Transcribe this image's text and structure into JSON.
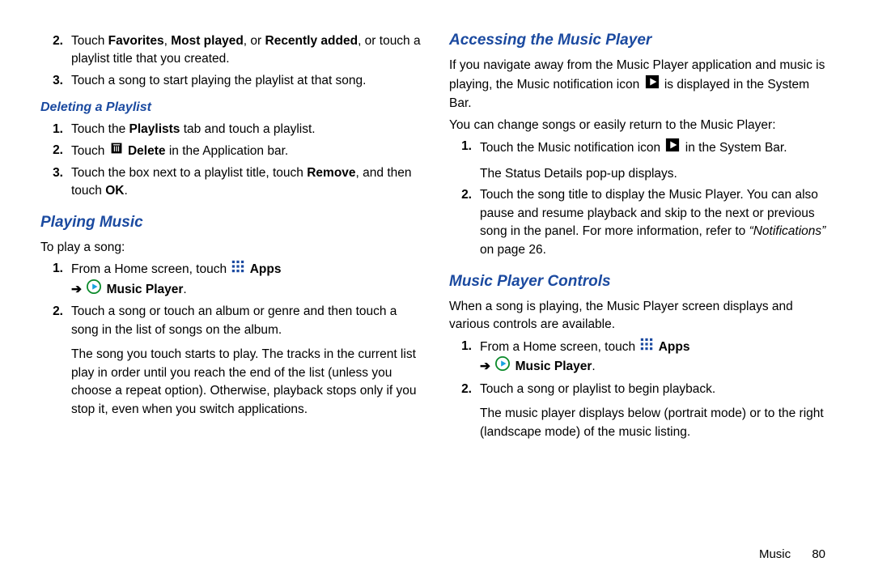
{
  "left": {
    "item2": {
      "num": "2.",
      "pre": "Touch ",
      "b1": "Favorites",
      "mid1": ", ",
      "b2": "Most played",
      "mid2": ", or ",
      "b3": "Recently added",
      "post": ", or touch a playlist title that you created."
    },
    "item3": {
      "num": "3.",
      "text": "Touch a song to start playing the playlist at that song."
    },
    "del_heading": "Deleting a Playlist",
    "del1": {
      "num": "1.",
      "pre": "Touch the ",
      "b": "Playlists",
      "post": " tab and touch a playlist."
    },
    "del2": {
      "num": "2.",
      "pre": "Touch ",
      "b": "Delete",
      "post": " in the Application bar."
    },
    "del3": {
      "num": "3.",
      "pre": "Touch the box next to a playlist title, touch ",
      "b1": "Remove",
      "mid": ", and then touch ",
      "b2": "OK",
      "post": "."
    },
    "play_heading": "Playing Music",
    "play_intro": "To play a song:",
    "play1": {
      "num": "1.",
      "pre": "From a Home screen, touch ",
      "apps": "Apps",
      "arrow": "➔",
      "mp": "Music Player",
      "post": "."
    },
    "play2": {
      "num": "2.",
      "text": "Touch a song or touch an album or genre and then touch a song in the list of songs on the album.",
      "follow": "The song you touch starts to play. The tracks in the current list play in order until you reach the end of the list (unless you choose a repeat option). Otherwise, playback stops only if you stop it, even when you switch applications."
    }
  },
  "right": {
    "acc_heading": "Accessing the Music Player",
    "acc_p1a": "If you navigate away from the Music Player application and music is playing, the Music notification icon ",
    "acc_p1b": " is displayed in the System Bar.",
    "acc_p2": "You can change songs or easily return to the Music Player:",
    "acc1": {
      "num": "1.",
      "pre": "Touch the Music notification icon ",
      "post": " in the System Bar.",
      "follow": "The Status Details pop-up displays."
    },
    "acc2": {
      "num": "2.",
      "pre": "Touch the song title to display the Music Player. You can also pause and resume playback and skip to the next or previous song in the panel. For more information, refer to ",
      "i": "“Notifications”",
      "post": " on page 26."
    },
    "ctl_heading": "Music Player Controls",
    "ctl_p1": "When a song is playing, the Music Player screen displays and various controls are available.",
    "ctl1": {
      "num": "1.",
      "pre": "From a Home screen, touch ",
      "apps": "Apps",
      "arrow": "➔",
      "mp": "Music Player",
      "post": "."
    },
    "ctl2": {
      "num": "2.",
      "text": "Touch a song or playlist to begin playback.",
      "follow": "The music player displays below (portrait mode) or to the right (landscape mode) of the music listing."
    }
  },
  "footer": {
    "section": "Music",
    "page": "80"
  }
}
